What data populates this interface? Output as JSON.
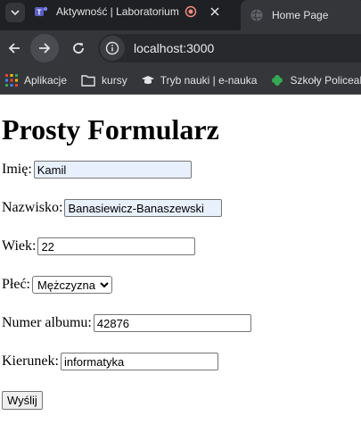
{
  "browser": {
    "tabs": [
      {
        "title": "Aktywność | Laboratorium"
      },
      {
        "title": "Home Page"
      }
    ],
    "url": "localhost:3000",
    "bookmarks": [
      {
        "label": "Aplikacje",
        "icon": "apps-grid-icon"
      },
      {
        "label": "kursy",
        "icon": "folder-icon"
      },
      {
        "label": "Tryb nauki | e-nauka",
        "icon": "graduation-cap-icon"
      },
      {
        "label": "Szkoły Policeal",
        "icon": "clover-icon"
      }
    ]
  },
  "form": {
    "title": "Prosty Formularz",
    "fields": {
      "first_name": {
        "label": "Imię:",
        "value": "Kamil"
      },
      "last_name": {
        "label": "Nazwisko:",
        "value": "Banasiewicz-Banaszewski"
      },
      "age": {
        "label": "Wiek:",
        "value": "22"
      },
      "gender": {
        "label": "Płeć:",
        "value": "Mężczyzna"
      },
      "album": {
        "label": "Numer albumu:",
        "value": "42876"
      },
      "major": {
        "label": "Kierunek:",
        "value": "informatyka"
      }
    },
    "submit_label": "Wyślij"
  },
  "colors": {
    "tabstrip": "#1f2023",
    "toolbar": "#35363a",
    "autofill": "#e8f0fe"
  }
}
